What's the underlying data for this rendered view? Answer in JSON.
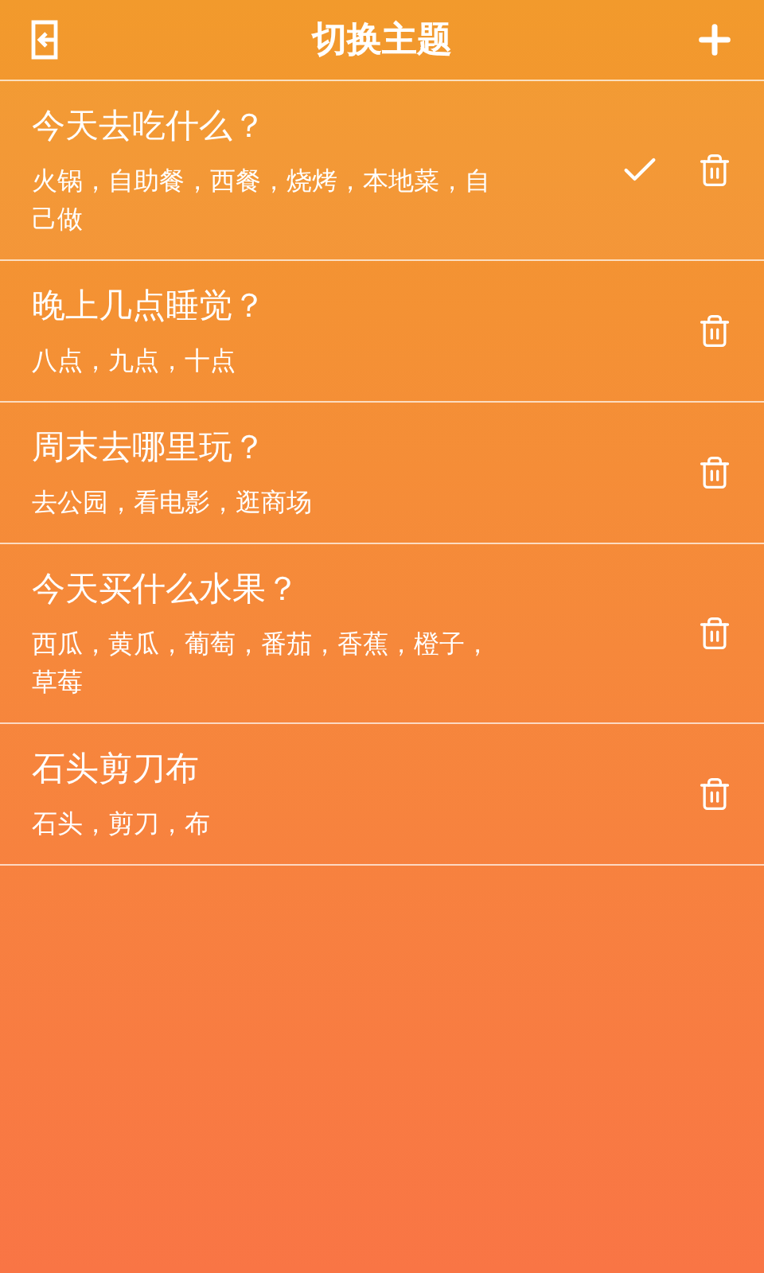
{
  "header": {
    "title": "切换主题"
  },
  "topics": [
    {
      "title": "今天去吃什么？",
      "options": "火锅，自助餐，西餐，烧烤，本地菜，自己做",
      "selected": true
    },
    {
      "title": "晚上几点睡觉？",
      "options": "八点，九点，十点",
      "selected": false
    },
    {
      "title": "周末去哪里玩？",
      "options": "去公园，看电影，逛商场",
      "selected": false
    },
    {
      "title": "今天买什么水果？",
      "options": "西瓜，黄瓜，葡萄，番茄，香蕉，橙子，草莓",
      "selected": false
    },
    {
      "title": "石头剪刀布",
      "options": "石头，剪刀，布",
      "selected": false
    }
  ]
}
